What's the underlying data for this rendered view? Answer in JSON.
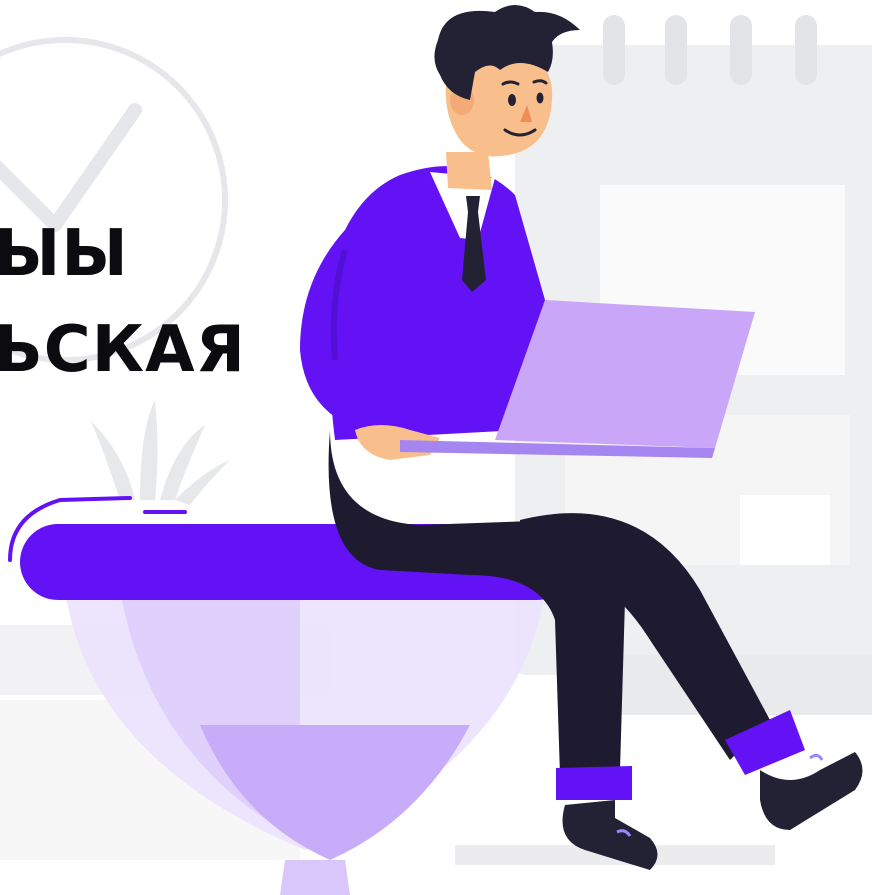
{
  "headline": {
    "line1": "ЫЫ",
    "line2": "ЬСКАЯ"
  },
  "colors": {
    "background": "#ffffff",
    "background_shapes": "#eeeff1",
    "purple_main": "#6311f5",
    "purple_light": "#b79cf6",
    "laptop": "#c9a6f8",
    "trousers": "#1e1b31",
    "skin": "#f8bf8c",
    "hair": "#232234",
    "text": "#0b0b10"
  },
  "illustration": {
    "subject": "man-with-laptop",
    "seat": "purple-platform",
    "decor": [
      "calendar-outline",
      "checkmark-circle",
      "plant",
      "hourglass-base"
    ]
  }
}
